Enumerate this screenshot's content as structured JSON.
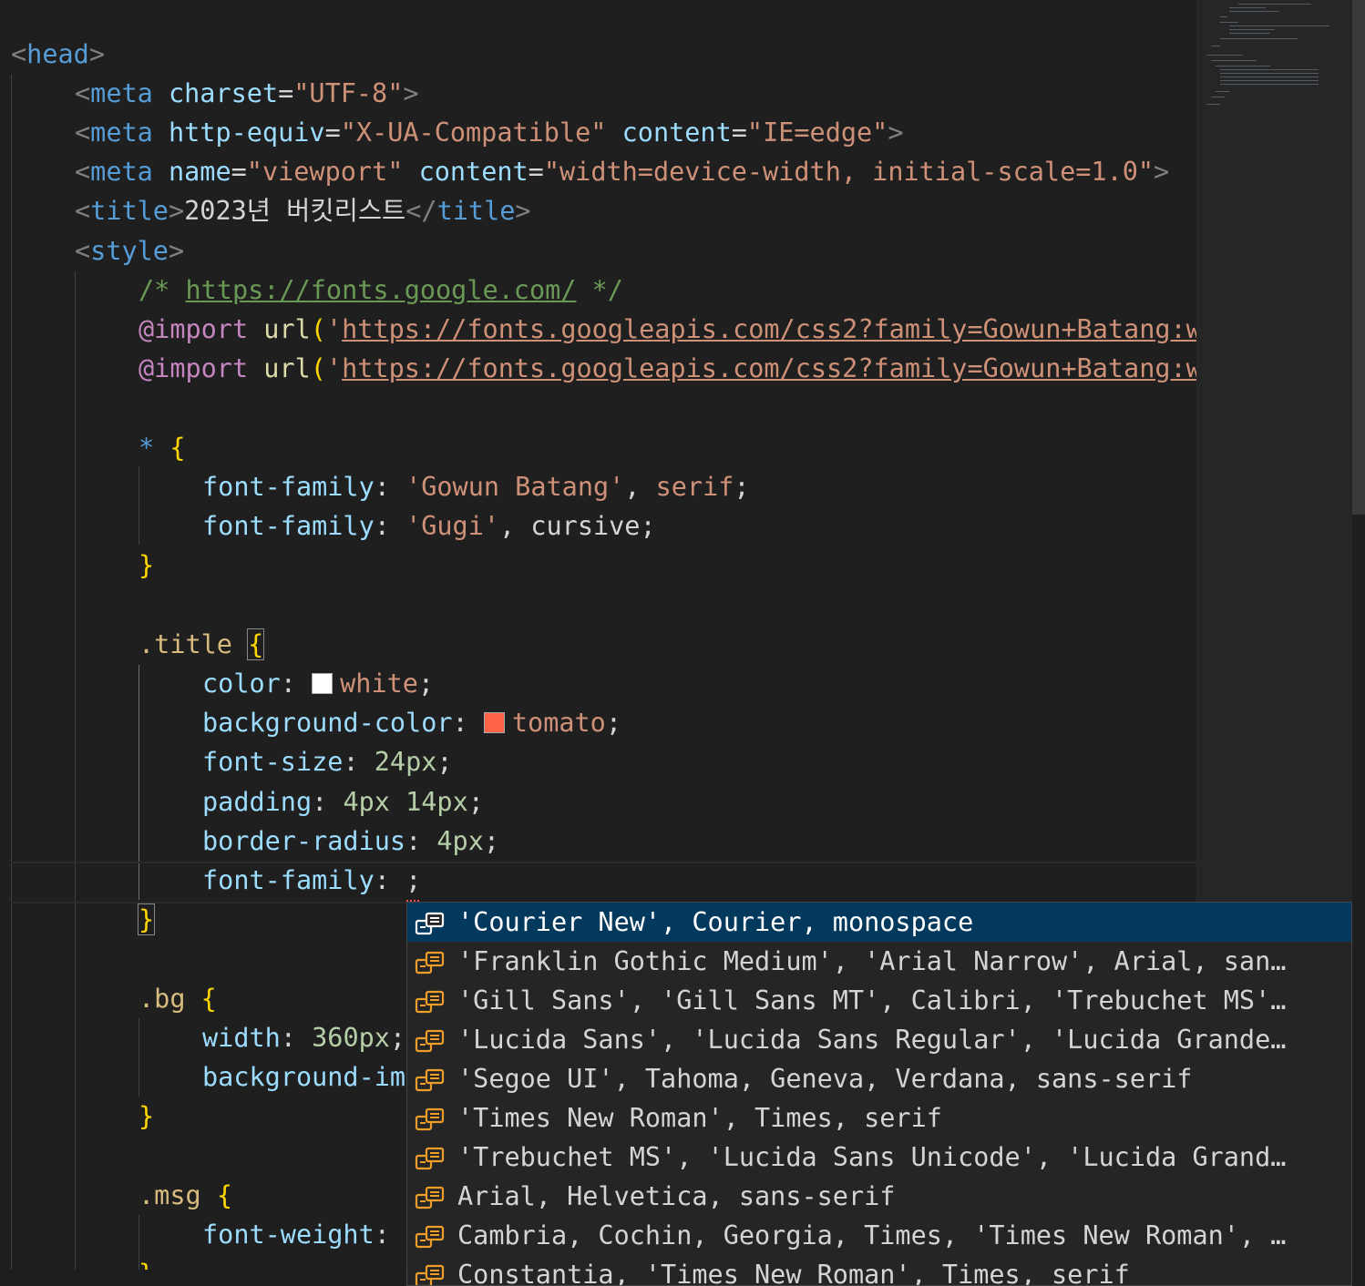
{
  "code": {
    "head_open": "head",
    "meta_charset": {
      "tag": "meta",
      "attr": "charset",
      "value": "\"UTF-8\""
    },
    "meta_compat": {
      "tag": "meta",
      "attr1": "http-equiv",
      "value1": "\"X-UA-Compatible\"",
      "attr2": "content",
      "value2": "\"IE=edge\""
    },
    "meta_viewport": {
      "tag": "meta",
      "attr1": "name",
      "value1": "\"viewport\"",
      "attr2": "content",
      "value2": "\"width=device-width, initial-scale=1.0\""
    },
    "title_line": {
      "tag": "title",
      "text": "2023년 버킷리스트"
    },
    "style_open": "style",
    "comment": {
      "open": "/* ",
      "url": "https://fonts.google.com/",
      "close": " */"
    },
    "imports": [
      {
        "kw": "@import",
        "fn": "url",
        "quote": "'",
        "url": "https://fonts.googleapis.com/css2?family=Gowun+Batang:w"
      },
      {
        "kw": "@import",
        "fn": "url",
        "quote": "'",
        "url": "https://fonts.googleapis.com/css2?family=Gowun+Batang:w"
      }
    ],
    "universal_rule": {
      "selector": "*",
      "decls": [
        {
          "prop": "font-family",
          "values": [
            "'Gowun Batang'",
            ", ",
            "serif"
          ]
        },
        {
          "prop": "font-family",
          "values": [
            "'Gugi'",
            ", ",
            "cursive"
          ]
        }
      ]
    },
    "title_rule": {
      "selector": ".title",
      "color_prop": "color",
      "color_value": "white",
      "color_swatch": "#ffffff",
      "bg_prop": "background-color",
      "bg_value": "tomato",
      "bg_swatch": "#ff6347",
      "fs_prop": "font-size",
      "fs_value": "24px",
      "pad_prop": "padding",
      "pad_value1": "4px",
      "pad_value2": "14px",
      "br_prop": "border-radius",
      "br_value": "4px",
      "ff_prop": "font-family"
    },
    "bg_rule": {
      "selector": ".bg",
      "width_prop": "width",
      "width_value": "360px",
      "bgimg_prop": "background-im"
    },
    "msg_rule": {
      "selector": ".msg",
      "fw_prop": "font-weight"
    }
  },
  "suggestions": [
    {
      "label": "'Courier New', Courier, monospace",
      "selected": true
    },
    {
      "label": "'Franklin Gothic Medium', 'Arial Narrow', Arial, san…"
    },
    {
      "label": "'Gill Sans', 'Gill Sans MT', Calibri, 'Trebuchet MS'…"
    },
    {
      "label": "'Lucida Sans', 'Lucida Sans Regular', 'Lucida Grande…"
    },
    {
      "label": "'Segoe UI', Tahoma, Geneva, Verdana, sans-serif"
    },
    {
      "label": "'Times New Roman', Times, serif"
    },
    {
      "label": "'Trebuchet MS', 'Lucida Sans Unicode', 'Lucida Grand…"
    },
    {
      "label": "Arial, Helvetica, sans-serif"
    },
    {
      "label": "Cambria, Cochin, Georgia, Times, 'Times New Roman', …"
    },
    {
      "label": "Constantia, 'Times New Roman', Times, serif"
    }
  ],
  "colors": {
    "selection": "#04395e",
    "icon": "#ee9d28"
  }
}
